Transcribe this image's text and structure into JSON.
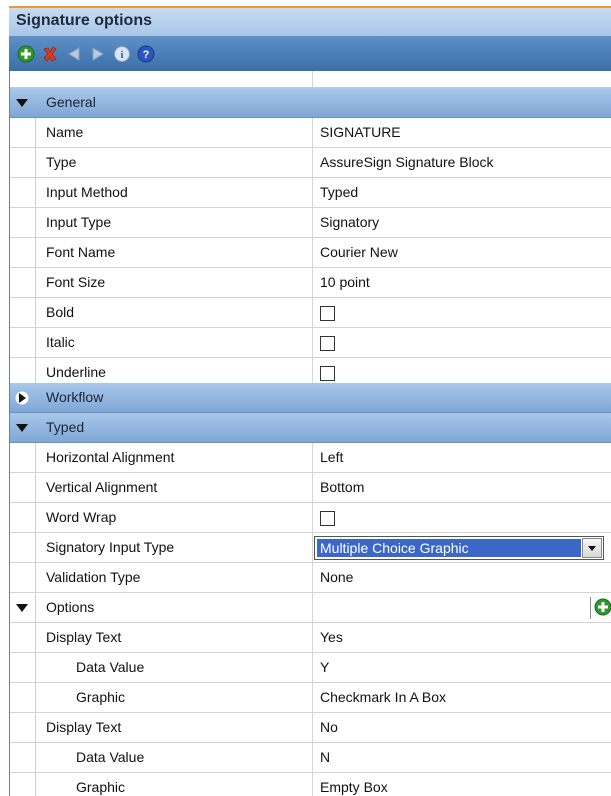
{
  "window": {
    "title": "Signature options"
  },
  "toolbar": {
    "icons": [
      "add-icon",
      "delete-icon",
      "move-left-icon",
      "move-right-icon",
      "info-icon",
      "help-icon"
    ]
  },
  "categories": {
    "general": "General",
    "workflow": "Workflow",
    "typed": "Typed",
    "options": "Options"
  },
  "general": {
    "rows": [
      {
        "label": "Name",
        "value": "SIGNATURE"
      },
      {
        "label": "Type",
        "value": "AssureSign Signature Block"
      },
      {
        "label": "Input Method",
        "value": "Typed"
      },
      {
        "label": "Input Type",
        "value": "Signatory"
      },
      {
        "label": "Font Name",
        "value": "Courier New"
      },
      {
        "label": "Font Size",
        "value": "10 point"
      },
      {
        "label": "Bold",
        "value": ""
      },
      {
        "label": "Italic",
        "value": ""
      },
      {
        "label": "Underline",
        "value": ""
      }
    ]
  },
  "typed": {
    "rows": [
      {
        "label": "Horizontal Alignment",
        "value": "Left"
      },
      {
        "label": "Vertical Alignment",
        "value": "Bottom"
      },
      {
        "label": "Word Wrap",
        "value": ""
      },
      {
        "label": "Signatory Input Type",
        "value": "Multiple Choice Graphic"
      },
      {
        "label": "Validation Type",
        "value": "None"
      }
    ]
  },
  "options": {
    "rows": [
      {
        "label": "Display Text",
        "value": "Yes"
      },
      {
        "label": "Data Value",
        "value": "Y"
      },
      {
        "label": "Graphic",
        "value": "Checkmark In A Box"
      },
      {
        "label": "Display Text",
        "value": "No"
      },
      {
        "label": "Data Value",
        "value": "N"
      },
      {
        "label": "Graphic",
        "value": "Empty Box"
      }
    ]
  },
  "colors": {
    "title_accent": "#e89b30",
    "category_band": "#8fb3de",
    "toolbar": "#4a7fb8",
    "selection": "#3b67c9"
  }
}
